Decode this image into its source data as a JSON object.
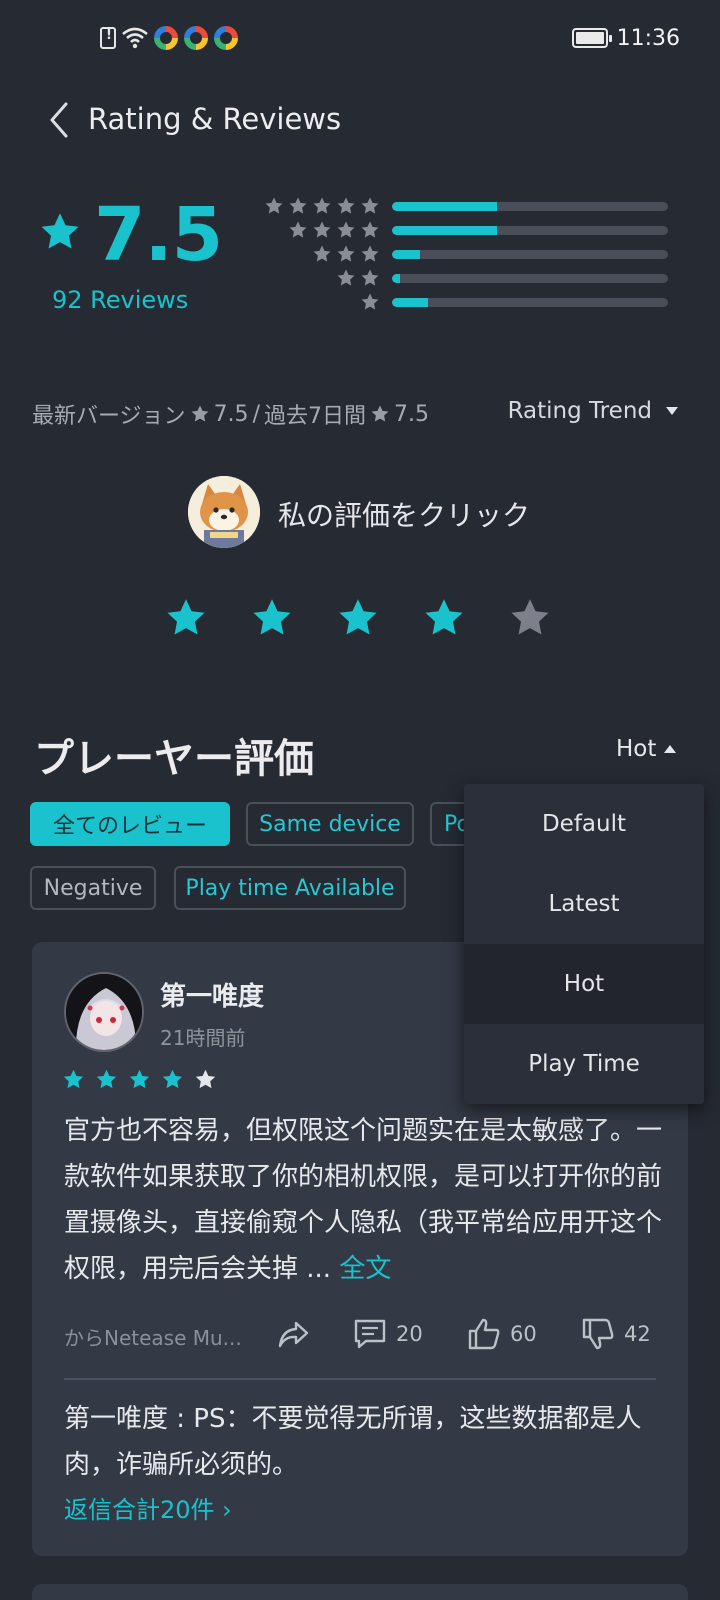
{
  "status_bar": {
    "time": "11:36",
    "battery_level": 1.0
  },
  "header": {
    "title": "Rating & Reviews",
    "back_icon": "chevron-left-icon"
  },
  "rating": {
    "score": "7.5",
    "reviews_label": "92 Reviews",
    "distribution": [
      {
        "stars": 5,
        "fraction": 0.38
      },
      {
        "stars": 4,
        "fraction": 0.38
      },
      {
        "stars": 3,
        "fraction": 0.1
      },
      {
        "stars": 2,
        "fraction": 0.03
      },
      {
        "stars": 1,
        "fraction": 0.13
      }
    ]
  },
  "version": {
    "latest_label": "最新バージョン",
    "latest_score": "7.5",
    "separator": "/",
    "past_label": "過去7日間",
    "past_score": "7.5",
    "trend_label": "Rating Trend"
  },
  "my_rating": {
    "prompt": "私の評価をクリック",
    "stars_filled": 4,
    "stars_total": 5
  },
  "section": {
    "title": "プレーヤー評価",
    "sort_label": "Hot"
  },
  "filters": [
    "全てのレビュー",
    "Same device",
    "Po",
    "Negative",
    "Play time Available"
  ],
  "sort_menu": {
    "options": [
      "Default",
      "Latest",
      "Hot",
      "Play Time"
    ],
    "selected": "Hot"
  },
  "review": {
    "author": "第一唯度",
    "time": "21時間前",
    "stars_filled": 4,
    "stars_total": 5,
    "body": "官方也不容易，但权限这个问题实在是太敏感了。一款软件如果获取了你的相机权限，是可以打开你的前置摄像头，直接偷窥个人隐私（我平常给应用开这个权限，用完后会关掉 ...",
    "full_text_link": "全文",
    "source": "からNetease Mu...",
    "comments": "20",
    "likes": "60",
    "dislikes": "42",
    "reply": "第一唯度 : PS：不要觉得无所谓，这些数据都是人肉，诈骗所必须的。",
    "reply_total": "返信合計20件 ›"
  },
  "colors": {
    "accent": "#19c2cd",
    "background": "#262a33",
    "card": "#343946",
    "star_empty": "#7d808a"
  }
}
